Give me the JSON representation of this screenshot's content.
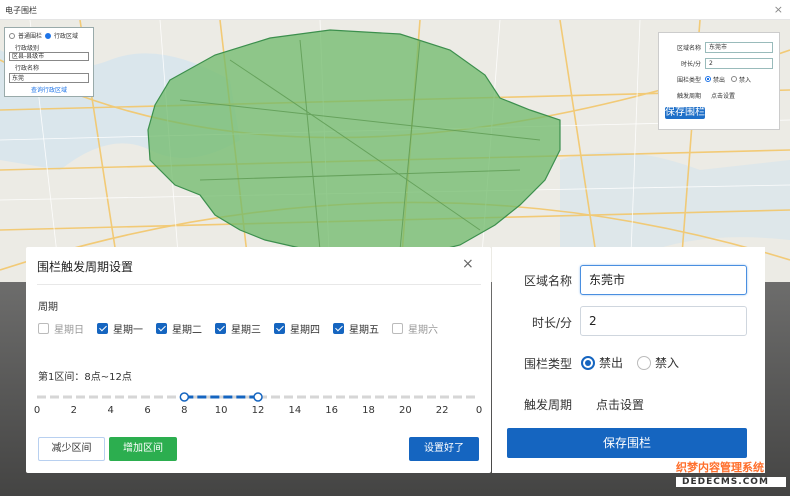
{
  "window": {
    "title": "电子围栏",
    "close_glyph": "×"
  },
  "map_panel_left": {
    "mode_normal": "普通围栏",
    "mode_admin": "行政区域",
    "admin_level_label": "行政级别",
    "admin_level_value": "区县-县级市",
    "admin_name_label": "行政名称",
    "admin_name_value": "东莞",
    "query_link": "查询行政区域"
  },
  "map_panel_right": {
    "region_label": "区域名称",
    "region_value": "东莞市",
    "duration_label": "时长/分",
    "duration_value": "2",
    "type_label": "围栏类型",
    "type_option1": "禁出",
    "type_option2": "禁入",
    "period_label": "触发周期",
    "period_value": "点击设置",
    "save_label": "保存围栏"
  },
  "dialog": {
    "title": "围栏触发周期设置",
    "close_glyph": "×",
    "period_label": "周期",
    "weekdays": [
      {
        "label": "星期日",
        "checked": false
      },
      {
        "label": "星期一",
        "checked": true
      },
      {
        "label": "星期二",
        "checked": true
      },
      {
        "label": "星期三",
        "checked": true
      },
      {
        "label": "星期四",
        "checked": true
      },
      {
        "label": "星期五",
        "checked": true
      },
      {
        "label": "星期六",
        "checked": false
      }
    ],
    "interval_text": "第1区间：8点~12点",
    "slider": {
      "min": 0,
      "max": 24,
      "start": 8,
      "end": 12,
      "active_color": "#1565c0"
    },
    "tick_labels": [
      "0",
      "2",
      "4",
      "6",
      "8",
      "10",
      "12",
      "14",
      "16",
      "18",
      "20",
      "22",
      "0"
    ],
    "btn_minus": "减少区间",
    "btn_add": "增加区间",
    "btn_ok": "设置好了"
  },
  "form": {
    "region_label": "区域名称",
    "region_value": "东莞市",
    "duration_label": "时长/分",
    "duration_value": "2",
    "type_label": "围栏类型",
    "type_option1": "禁出",
    "type_option2": "禁入",
    "type_selected": "禁出",
    "period_label": "触发周期",
    "period_value": "点击设置",
    "save_label": "保存围栏"
  },
  "watermark": {
    "line1": "织梦内容管理系统",
    "line2": "DEDECMS.COM"
  },
  "colors": {
    "primary": "#1565c0",
    "green": "#2cae4f",
    "fence_fill": "#6fb96a"
  }
}
